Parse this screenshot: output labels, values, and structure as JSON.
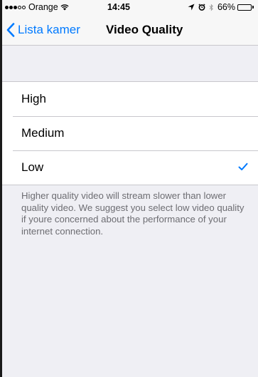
{
  "status_bar": {
    "carrier": "Orange",
    "time": "14:45",
    "battery": "66%",
    "battery_level": 0.66,
    "icons": [
      "wifi-icon",
      "location-icon",
      "alarm-icon",
      "bluetooth-icon",
      "battery-icon"
    ]
  },
  "nav": {
    "back_label": "Lista kamer",
    "title": "Video Quality",
    "accent_color": "#007aff"
  },
  "options": [
    {
      "label": "High",
      "selected": false
    },
    {
      "label": "Medium",
      "selected": false
    },
    {
      "label": "Low",
      "selected": true
    }
  ],
  "footer_note": "Higher quality video will stream slower than lower quality video. We suggest you select low video quality if youre concerned about the performance of your internet connection."
}
